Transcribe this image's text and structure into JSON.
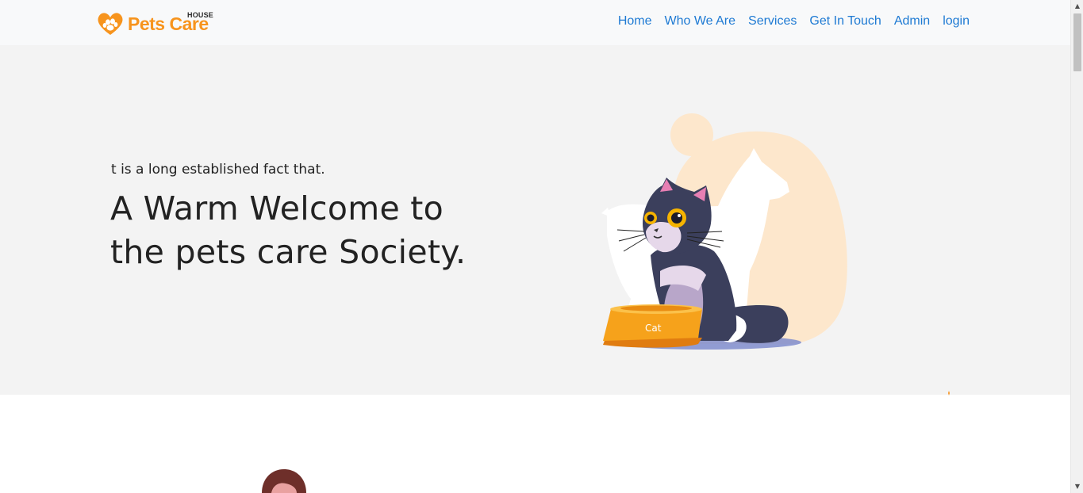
{
  "brand": {
    "name": "Pets Care",
    "tag": "HOUSE",
    "accent_color": "#f7941d"
  },
  "nav": {
    "items": [
      {
        "label": "Home"
      },
      {
        "label": "Who We Are"
      },
      {
        "label": "Services"
      },
      {
        "label": "Get In Touch"
      },
      {
        "label": "Admin"
      },
      {
        "label": "login"
      }
    ],
    "link_color": "#1e7ad3"
  },
  "hero": {
    "subtitle": "t is a long established fact that.",
    "title": "A Warm Welcome to the pets care Society.",
    "illustration": "cat-and-dog-illustration",
    "bowl_label": "Cat"
  },
  "icons": {
    "logo": "paw-heart-icon",
    "scroll_up": "triangle-up-icon",
    "scroll_down": "triangle-down-icon"
  }
}
